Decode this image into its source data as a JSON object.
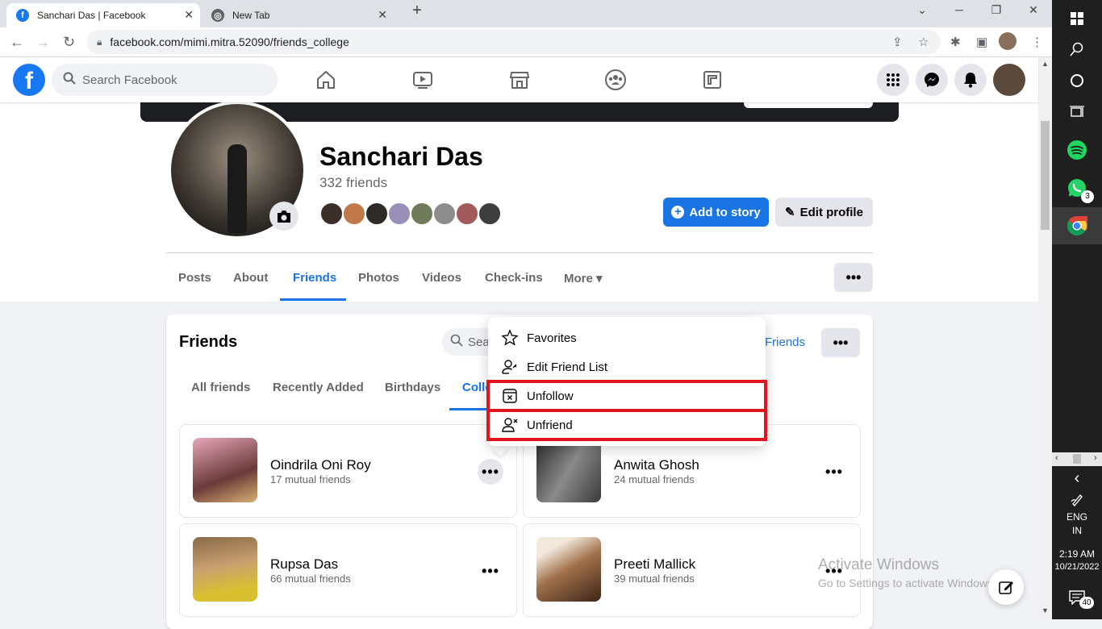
{
  "browser": {
    "tabs": [
      {
        "title": "Sanchari Das | Facebook",
        "active": true
      },
      {
        "title": "New Tab",
        "active": false
      }
    ],
    "url": "facebook.com/mimi.mitra.52090/friends_college"
  },
  "fb_header": {
    "logo": "f",
    "search_placeholder": "Search Facebook"
  },
  "profile": {
    "name": "Sanchari Das",
    "friend_count": "332 friends",
    "add_story": "Add to story",
    "edit_profile": "Edit profile",
    "tabs": [
      "Posts",
      "About",
      "Friends",
      "Photos",
      "Videos",
      "Check-ins",
      "More"
    ],
    "more_dropdown": "▾"
  },
  "friends_section": {
    "title": "Friends",
    "search_placeholder": "Sea",
    "find_friends": "Friends",
    "tabs": [
      "All friends",
      "Recently Added",
      "Birthdays",
      "Colle"
    ],
    "friends": [
      {
        "name": "Oindrila Oni Roy",
        "mutual": "17 mutual friends"
      },
      {
        "name": "Anwita Ghosh",
        "mutual": "24 mutual friends"
      },
      {
        "name": "Rupsa Das",
        "mutual": "66 mutual friends"
      },
      {
        "name": "Preeti Mallick",
        "mutual": "39 mutual friends"
      }
    ]
  },
  "menu": {
    "items": [
      {
        "label": "Favorites",
        "icon": "star-icon"
      },
      {
        "label": "Edit Friend List",
        "icon": "edit-friend-list-icon"
      },
      {
        "label": "Unfollow",
        "icon": "unfollow-icon",
        "highlighted": true
      },
      {
        "label": "Unfriend",
        "icon": "unfriend-icon",
        "highlighted": true
      }
    ]
  },
  "watermark": {
    "line1": "Activate Windows",
    "line2": "Go to Settings to activate Windows."
  },
  "taskbar": {
    "whatsapp_badge": "3",
    "lang1": "ENG",
    "lang2": "IN",
    "time": "2:19 AM",
    "date": "10/21/2022",
    "notification_count": "40"
  },
  "colors": {
    "fb_blue": "#1b74e4",
    "highlight_red": "#e0161e"
  }
}
